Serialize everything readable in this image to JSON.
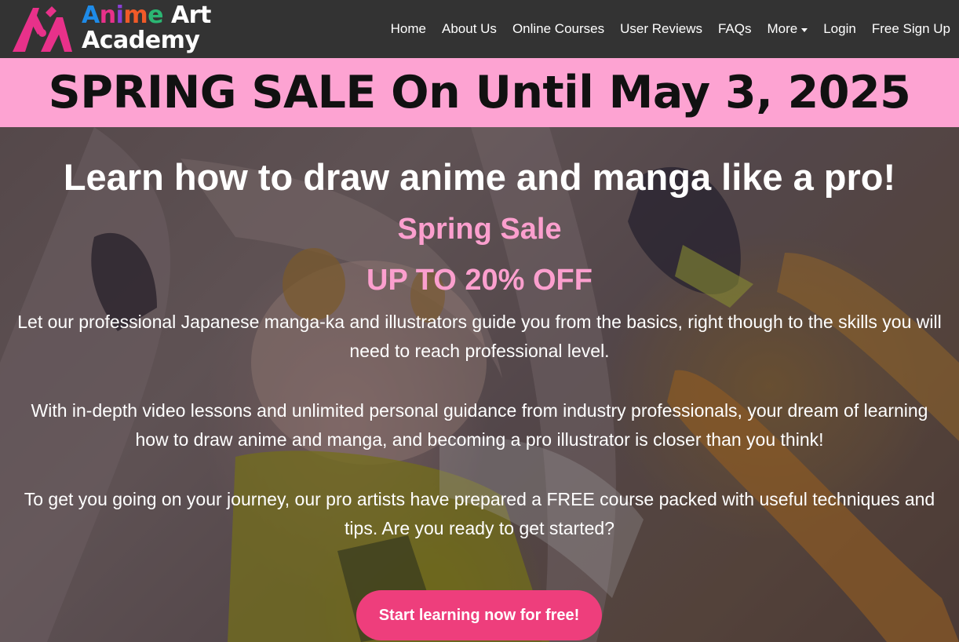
{
  "brand": {
    "logo_line1_parts": [
      "A",
      "n",
      "i",
      "m",
      "e"
    ],
    "logo_line1_suffix": " Art",
    "logo_line2": "Academy",
    "logo_icon": "kanji-logo-icon",
    "colors": {
      "pink": "#e8318a",
      "blue": "#1e8be8",
      "purple": "#8b3fd6",
      "orange": "#f05a28",
      "green": "#2bb673"
    }
  },
  "nav": {
    "items": [
      {
        "label": "Home"
      },
      {
        "label": "About Us"
      },
      {
        "label": "Online Courses"
      },
      {
        "label": "User Reviews"
      },
      {
        "label": "FAQs"
      },
      {
        "label": "More",
        "dropdown": true
      },
      {
        "label": "Login"
      },
      {
        "label": "Free Sign Up"
      }
    ]
  },
  "banner": {
    "text": "SPRING SALE On Until May 3, 2025",
    "background": "#fda3d2"
  },
  "hero": {
    "title": "Learn how to draw anime and manga like a pro!",
    "sale_label": "Spring Sale",
    "discount": "UP TO 20% OFF",
    "paragraphs": [
      "Let our professional Japanese manga-ka and illustrators guide you from the basics, right though to the skills you will need to reach professional level.",
      "With in-depth video lessons and unlimited personal guidance from industry professionals, your dream of learning how to draw anime and manga, and becoming a pro illustrator is closer than you think!",
      "To get you going on your journey, our pro artists have prepared a FREE course packed with useful techniques and tips. Are you ready to get started?"
    ],
    "cta": "Start learning now for free!",
    "accent_color": "#fb9fce",
    "cta_color": "#ee3e7c"
  }
}
